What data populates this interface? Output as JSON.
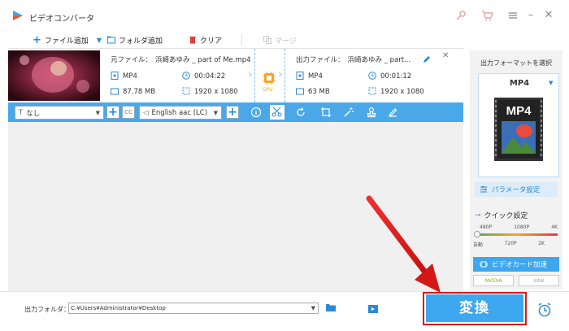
{
  "app": {
    "title": "ビデオコンバータ"
  },
  "toolbar": {
    "add_file": "ファイル追加",
    "add_folder": "フォルダ追加",
    "clear": "クリア",
    "merge": "マージ"
  },
  "source": {
    "label": "元ファイル：",
    "filename": "浜崎あゆみ _ part of Me.mp4",
    "format": "MP4",
    "duration": "00:04:22",
    "size": "87.78 MB",
    "resolution": "1920 x 1080"
  },
  "output": {
    "label": "出力ファイル：",
    "filename": "浜崎あゆみ _ part...",
    "format": "MP4",
    "duration": "00:01:12",
    "size": "63 MB",
    "resolution": "1920 x 1080"
  },
  "gpu_label": "GPU",
  "editbar": {
    "subtitle": "なし",
    "audio": "English aac (LC)"
  },
  "bottom": {
    "folder_label": "出力フォルダ：",
    "folder_path": "C:¥Users¥Administrator¥Desktop",
    "convert": "変換"
  },
  "side": {
    "select_format": "出力フォーマットを選択",
    "format": "MP4",
    "params": "パラメータ設定",
    "quick": "クイック設定",
    "quality_top": [
      "480P",
      "1080P",
      "4K"
    ],
    "quality_bottom": [
      "自動",
      "720P",
      "2K"
    ],
    "gpu_accel": "ビデオカード加速",
    "nvidia": "NVIDIA",
    "intel": "Intel"
  },
  "colors": {
    "accent": "#3da7ef",
    "arrow": "#e02020"
  }
}
